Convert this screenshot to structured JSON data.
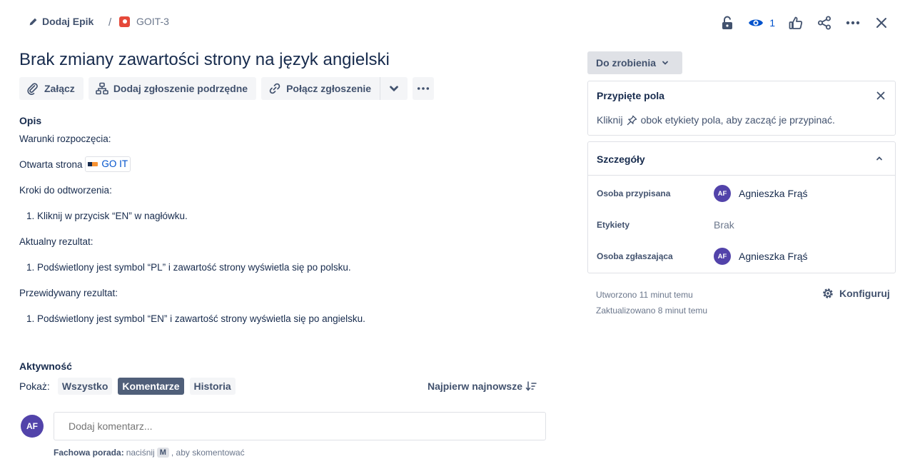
{
  "header": {
    "add_epic_label": "Dodaj Epik",
    "breadcrumb_separator": "/",
    "issue_key": "GOIT-3",
    "watch_count": "1"
  },
  "issue": {
    "title": "Brak zmiany zawartości strony na język angielski"
  },
  "toolbar": {
    "attach_label": "Załącz",
    "add_child_label": "Dodaj zgłoszenie podrzędne",
    "link_label": "Połącz zgłoszenie"
  },
  "description": {
    "label": "Opis",
    "preconditions_heading": "Warunki rozpoczęcia:",
    "open_page_text": "Otwarta strona",
    "link_text": "GO IT",
    "steps_heading": "Kroki do odtworzenia:",
    "step_1": "1.  Kliknij w przycisk “EN” w nagłówku.",
    "actual_heading": "Aktualny rezultat:",
    "actual_1": "1. Podświetlony jest symbol “PL” i zawartość strony wyświetla się po polsku.",
    "expected_heading": "Przewidywany rezultat:",
    "expected_1": "1. Podświetlony jest symbol “EN” i zawartość strony wyświetla się po angielsku."
  },
  "activity": {
    "label": "Aktywność",
    "show_label": "Pokaż:",
    "filters": [
      "Wszystko",
      "Komentarze",
      "Historia"
    ],
    "active_filter": "Komentarze",
    "sort_label": "Najpierw najnowsze",
    "user_initials": "AF",
    "comment_placeholder": "Dodaj komentarz...",
    "tip_bold": "Fachowa porada:",
    "tip_before": "naciśnij",
    "tip_key": "M",
    "tip_after": ", aby skomentować"
  },
  "sidebar": {
    "status_label": "Do zrobienia",
    "pinned_title": "Przypięte pola",
    "pinned_text_before": "Kliknij",
    "pinned_text_after": "obok etykiety pola, aby zacząć je przypinać.",
    "details_title": "Szczegóły",
    "fields": [
      {
        "label": "Osoba przypisana",
        "value": "Agnieszka Frąś",
        "initials": "AF"
      },
      {
        "label": "Etykiety",
        "value": "Brak"
      },
      {
        "label": "Osoba zgłaszająca",
        "value": "Agnieszka Frąś",
        "initials": "AF"
      }
    ],
    "created": "Utworzono 11 minut temu",
    "updated": "Zaktualizowano 8 minut temu",
    "configure_label": "Konfiguruj"
  },
  "colors": {
    "accent": "#0052cc",
    "avatar": "#5243aa",
    "bug": "#e5493a",
    "active_pill": "#505f79"
  }
}
